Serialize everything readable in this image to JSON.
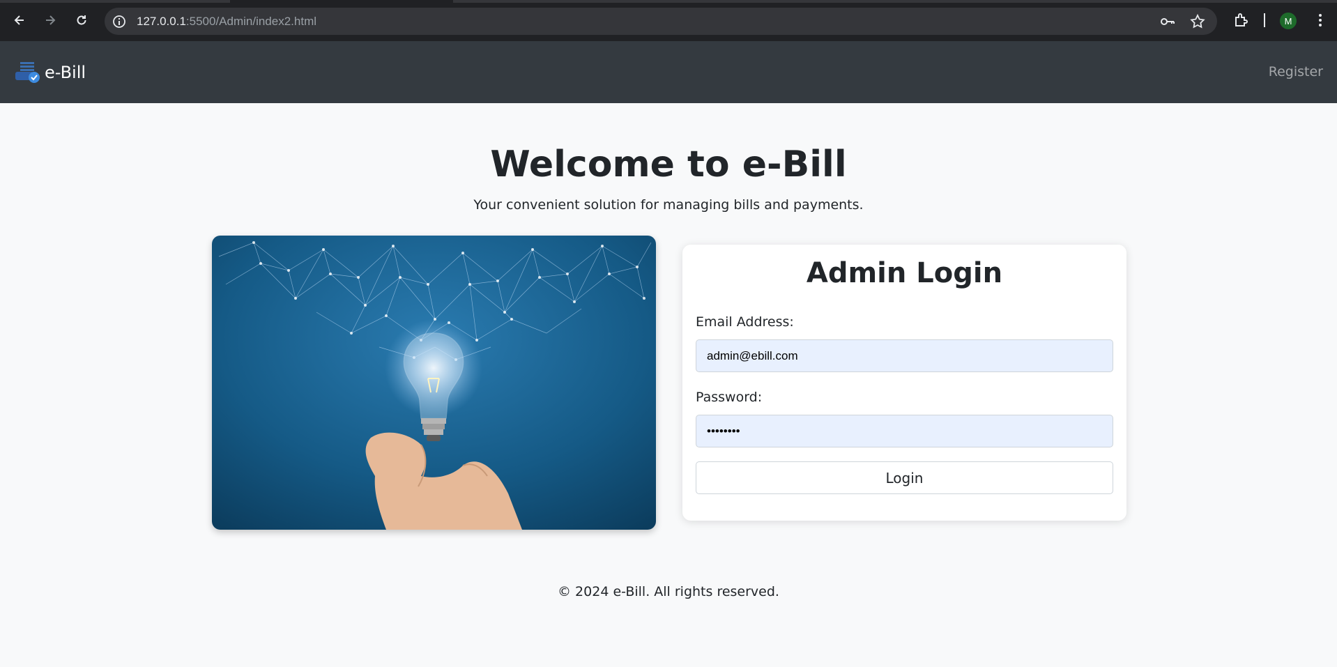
{
  "browser": {
    "url_host": "127.0.0.1",
    "url_rest": ":5500/Admin/index2.html",
    "profile_initial": "M"
  },
  "navbar": {
    "brand": "e-Bill",
    "register_label": "Register"
  },
  "hero": {
    "title": "Welcome to e-Bill",
    "subtitle": "Your convenient solution for managing bills and payments."
  },
  "login": {
    "title": "Admin Login",
    "email_label": "Email Address:",
    "email_value": "admin@ebill.com",
    "password_label": "Password:",
    "password_value": "••••••••",
    "button_label": "Login"
  },
  "footer": {
    "text": "© 2024 e-Bill. All rights reserved."
  },
  "colors": {
    "navbar_bg": "#343a40",
    "page_bg": "#f8f9fa",
    "autofill_bg": "#e8f0fe"
  }
}
